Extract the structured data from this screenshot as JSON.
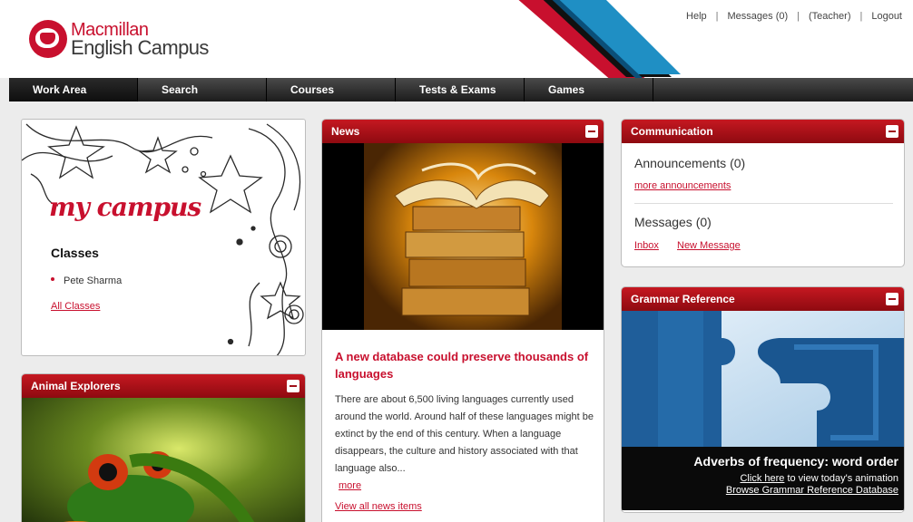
{
  "brand": {
    "line1": "Macmillan",
    "line2": "English Campus"
  },
  "toplinks": {
    "help": "Help",
    "messages": "Messages (0)",
    "teacher": "(Teacher)",
    "logout": "Logout"
  },
  "nav": {
    "items": [
      "Work Area",
      "Search",
      "Courses",
      "Tests & Exams",
      "Games"
    ],
    "active": "Work Area"
  },
  "mycampus": {
    "title": "my campus",
    "classes_heading": "Classes",
    "class_item": "Pete Sharma",
    "all_classes": "All Classes"
  },
  "animal": {
    "title": "Animal Explorers"
  },
  "news": {
    "title": "News",
    "headline": "A new database could preserve thousands of languages",
    "body": "There are about 6,500 living languages currently used around the world. Around half of these languages might be extinct by the end of this century. When a language disappears, the culture and history associated with that language also...",
    "more": "more",
    "view_all": "View all news items"
  },
  "communication": {
    "title": "Communication",
    "announcements": "Announcements (0)",
    "more_announcements": "more announcements",
    "messages": "Messages (0)",
    "inbox": "Inbox",
    "new_message": "New Message"
  },
  "grammar": {
    "title": "Grammar Reference",
    "feature_title": "Adverbs of frequency: word order",
    "click_here": "Click here",
    "click_suffix": " to view today's animation",
    "browse": "Browse Grammar Reference Database"
  },
  "colors": {
    "accent": "#c8102e",
    "nav": "#1c1c1c",
    "panel_head": "#b01018"
  }
}
